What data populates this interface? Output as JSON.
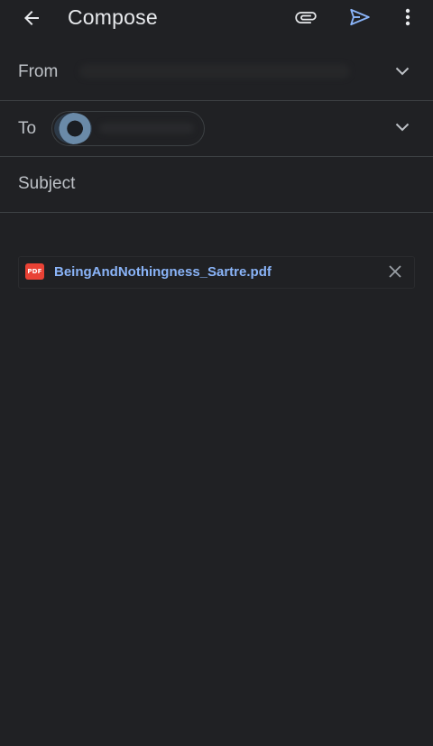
{
  "app_bar": {
    "title": "Compose",
    "icons": {
      "back": "arrow-back-icon",
      "attach": "paperclip-icon",
      "send": "send-icon",
      "more": "more-vert-icon"
    }
  },
  "fields": {
    "from_label": "From",
    "to_label": "To",
    "subject_placeholder": "Subject"
  },
  "attachment": {
    "badge": "PDF",
    "filename": "BeingAndNothingness_Sartre.pdf"
  },
  "colors": {
    "background": "#202124",
    "accent": "#8ab4f8",
    "pdf_red": "#e94235",
    "divider": "#3c4043"
  }
}
